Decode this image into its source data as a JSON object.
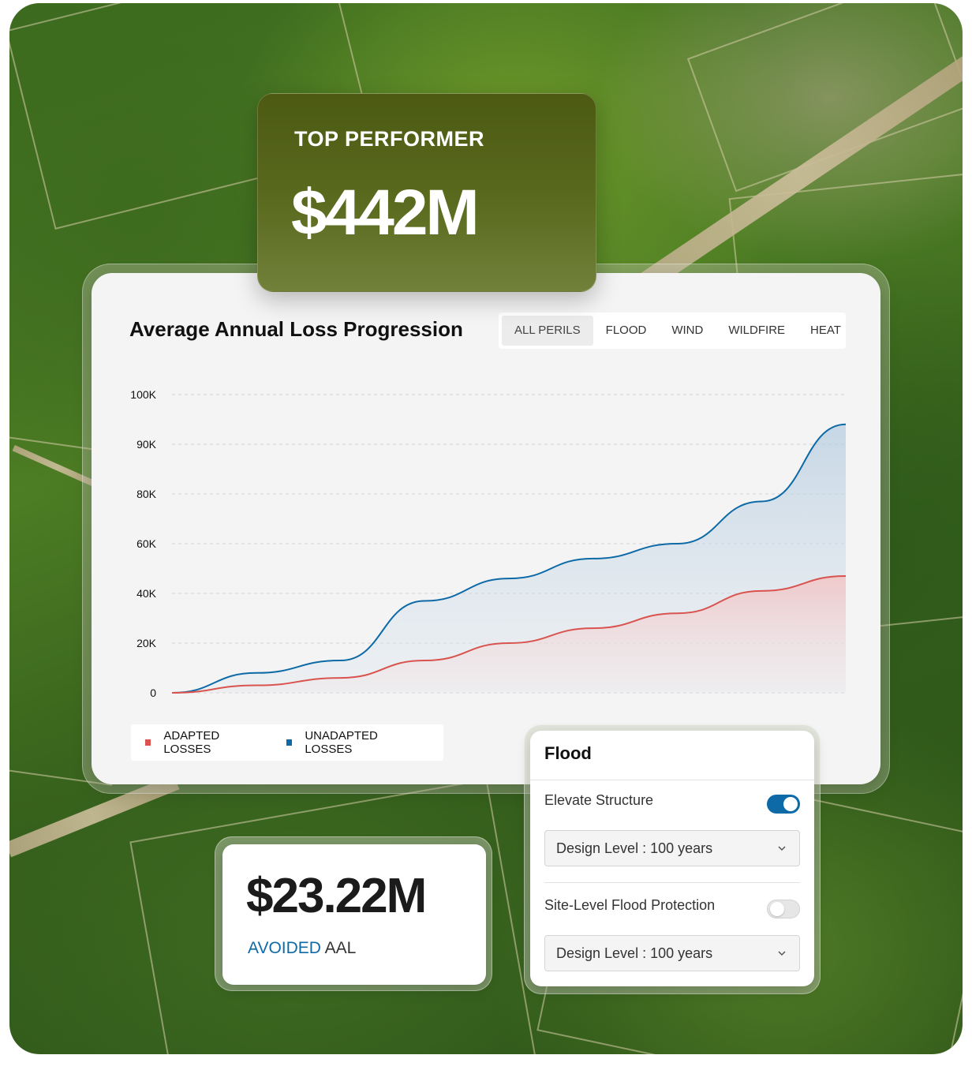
{
  "top_performer": {
    "label": "TOP PERFORMER",
    "value": "$442M"
  },
  "chart_panel": {
    "title": "Average Annual Loss Progression",
    "tabs": [
      {
        "label": "ALL PERILS",
        "active": true
      },
      {
        "label": "FLOOD",
        "active": false
      },
      {
        "label": "WIND",
        "active": false
      },
      {
        "label": "WILDFIRE",
        "active": false
      },
      {
        "label": "HEAT",
        "active": false
      }
    ],
    "legend": [
      {
        "label": "ADAPTED LOSSES",
        "color": "#d9534f"
      },
      {
        "label": "UNADAPTED LOSSES",
        "color": "#0d6aa6"
      }
    ]
  },
  "chart_data": {
    "type": "area",
    "title": "Average Annual Loss Progression",
    "xlabel": "",
    "ylabel": "",
    "y_tick_labels": [
      "0",
      "20K",
      "40K",
      "60K",
      "80K",
      "90K",
      "100K"
    ],
    "grid": true,
    "legend_position": "bottom-left",
    "series": [
      {
        "name": "UNADAPTED LOSSES",
        "color": "#0d6aa6",
        "values": [
          0,
          8,
          13,
          37,
          46,
          54,
          60,
          77,
          94
        ]
      },
      {
        "name": "ADAPTED LOSSES",
        "color": "#d9534f",
        "values": [
          0,
          3,
          6,
          13,
          20,
          26,
          32,
          41,
          47
        ]
      }
    ]
  },
  "flood_panel": {
    "title": "Flood",
    "options": [
      {
        "label": "Elevate Structure",
        "enabled": true,
        "select_value": "Design Level : 100 years"
      },
      {
        "label": "Site-Level Flood Protection",
        "enabled": false,
        "select_value": "Design Level : 100 years"
      }
    ],
    "icons": {
      "select": "chevron-down-icon"
    }
  },
  "avoided": {
    "value": "$23.22M",
    "label_accent": "AVOIDED",
    "label_rest": "AAL",
    "accent_color": "#0d6aa6"
  }
}
